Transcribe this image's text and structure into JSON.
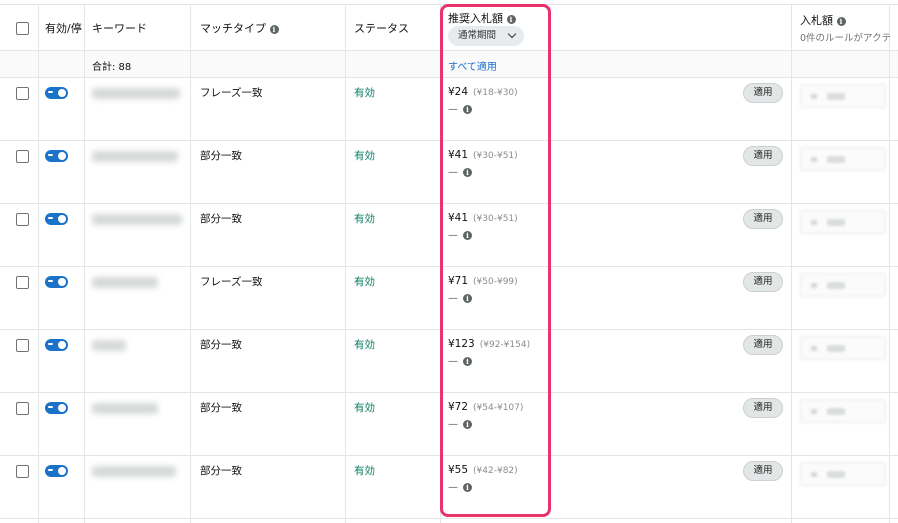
{
  "header": {
    "enabled": "有効/停",
    "keyword": "キーワード",
    "match_type": "マッチタイプ",
    "status": "ステータス",
    "suggested_bid": "推奨入札額",
    "period_selector": "通常期間",
    "bid": "入札額",
    "bid_rules_note": "0件のルールがアクテ"
  },
  "summary": {
    "total": "合計: 88",
    "apply_all": "すべて適用"
  },
  "rows": [
    {
      "match_type": "フレーズ一致",
      "status": "有効",
      "bid": "¥24",
      "range": "(¥18-¥30)",
      "sub": "—",
      "apply": "適用"
    },
    {
      "match_type": "部分一致",
      "status": "有効",
      "bid": "¥41",
      "range": "(¥30-¥51)",
      "sub": "—",
      "apply": "適用"
    },
    {
      "match_type": "部分一致",
      "status": "有効",
      "bid": "¥41",
      "range": "(¥30-¥51)",
      "sub": "—",
      "apply": "適用"
    },
    {
      "match_type": "フレーズ一致",
      "status": "有効",
      "bid": "¥71",
      "range": "(¥50-¥99)",
      "sub": "—",
      "apply": "適用"
    },
    {
      "match_type": "部分一致",
      "status": "有効",
      "bid": "¥123",
      "range": "(¥92-¥154)",
      "sub": "—",
      "apply": "適用"
    },
    {
      "match_type": "部分一致",
      "status": "有効",
      "bid": "¥72",
      "range": "(¥54-¥107)",
      "sub": "—",
      "apply": "適用"
    },
    {
      "match_type": "部分一致",
      "status": "有効",
      "bid": "¥55",
      "range": "(¥42-¥82)",
      "sub": "—",
      "apply": "適用"
    }
  ],
  "icons": {
    "info": "i"
  },
  "colors": {
    "toggle_on": "#1a73c8",
    "status_active": "#067d62",
    "link": "#1b6ac9",
    "highlight": "#e8336b"
  }
}
